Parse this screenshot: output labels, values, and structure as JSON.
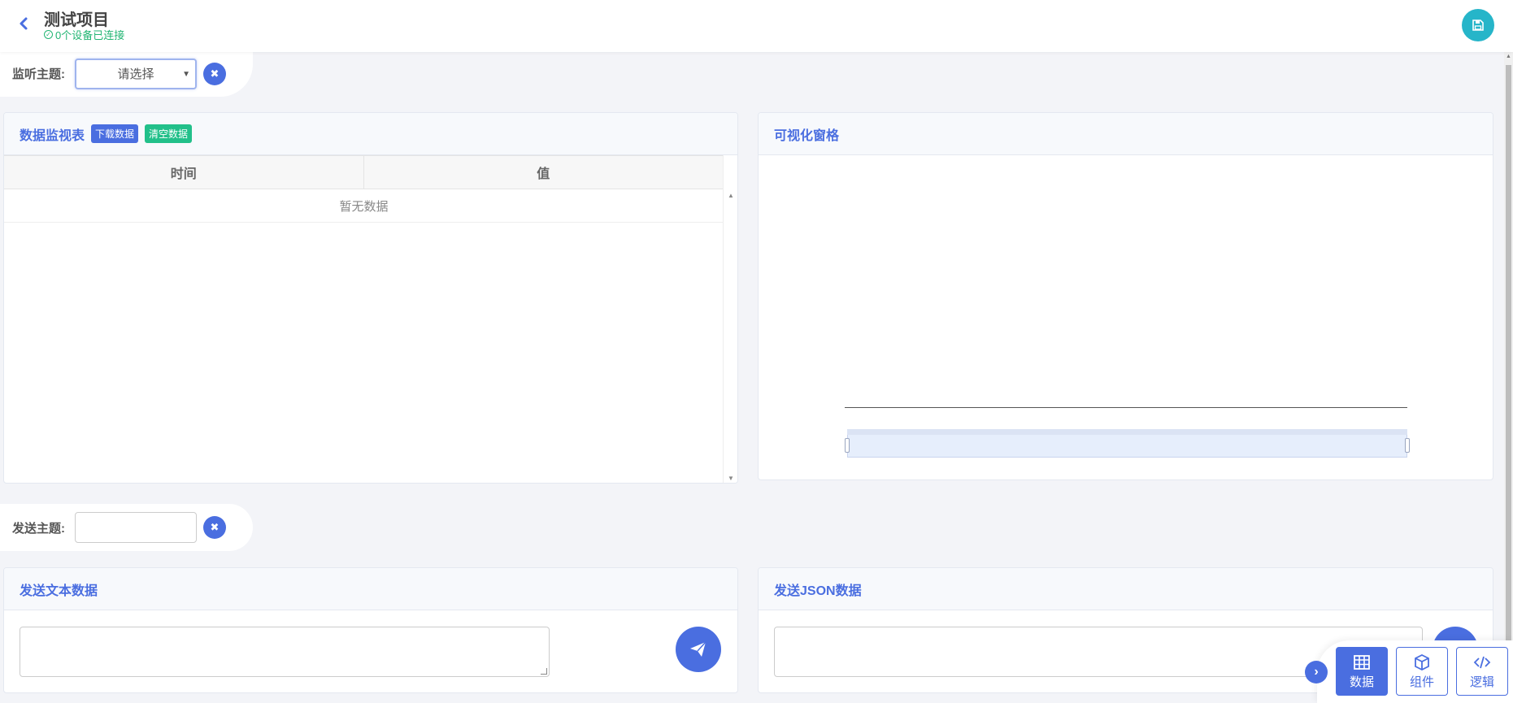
{
  "header": {
    "back_icon": "chevron-left-icon",
    "project_title": "测试项目",
    "device_status": "0个设备已连接",
    "save_icon": "save-icon",
    "accent": "#4a6ee0",
    "save_color": "#26b5c9",
    "status_color": "#22b573"
  },
  "listen_topic": {
    "label": "监听主题:",
    "select_value": "请选择",
    "clear_icon": "close-icon"
  },
  "send_topic": {
    "label": "发送主题:",
    "input_value": "",
    "clear_icon": "close-icon"
  },
  "data_monitor": {
    "title": "数据监视表",
    "download_label": "下载数据",
    "clear_label": "清空数据",
    "columns": [
      "时间",
      "值"
    ],
    "empty_text": "暂无数据"
  },
  "visualization": {
    "title": "可视化窗格"
  },
  "send_text": {
    "title": "发送文本数据",
    "value": "",
    "send_icon": "paper-plane-icon"
  },
  "send_json": {
    "title": "发送JSON数据",
    "value": ""
  },
  "toolbar": {
    "collapse_icon": "chevron-right-icon",
    "items": [
      {
        "label": "数据",
        "icon": "table-icon",
        "active": true
      },
      {
        "label": "组件",
        "icon": "cube-icon",
        "active": false
      },
      {
        "label": "逻辑",
        "icon": "code-icon",
        "active": false
      }
    ]
  }
}
